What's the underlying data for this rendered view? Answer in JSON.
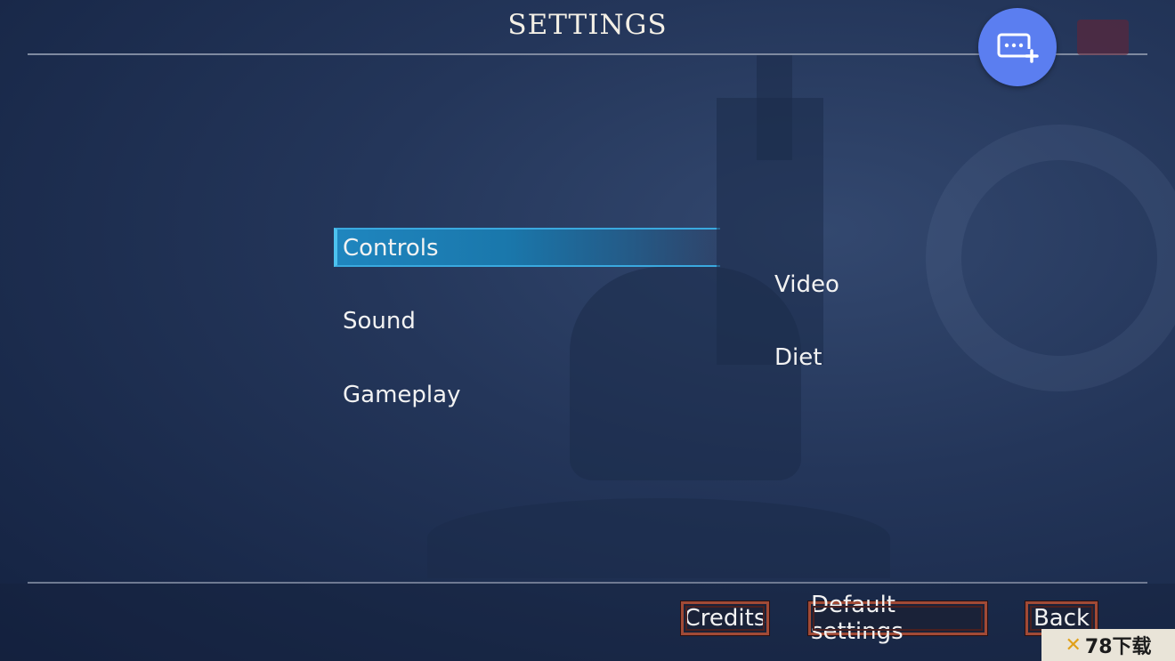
{
  "header": {
    "title": "SETTINGS"
  },
  "menu": {
    "left": [
      {
        "label": "Controls",
        "selected": true
      },
      {
        "label": "Sound",
        "selected": false
      },
      {
        "label": "Gameplay",
        "selected": false
      }
    ],
    "right": [
      {
        "label": "Video",
        "selected": false
      },
      {
        "label": "Diet",
        "selected": false
      }
    ]
  },
  "footer": {
    "credits_label": "Credits",
    "default_settings_label": "Default settings",
    "back_label": "Back"
  },
  "overlay": {
    "fab_icon": "message-add-icon",
    "accent_color": "#5b7ef0"
  },
  "watermark": {
    "text": "78下载"
  },
  "colors": {
    "selected_bar": "#1f86bf",
    "button_border": "#a14a36"
  }
}
